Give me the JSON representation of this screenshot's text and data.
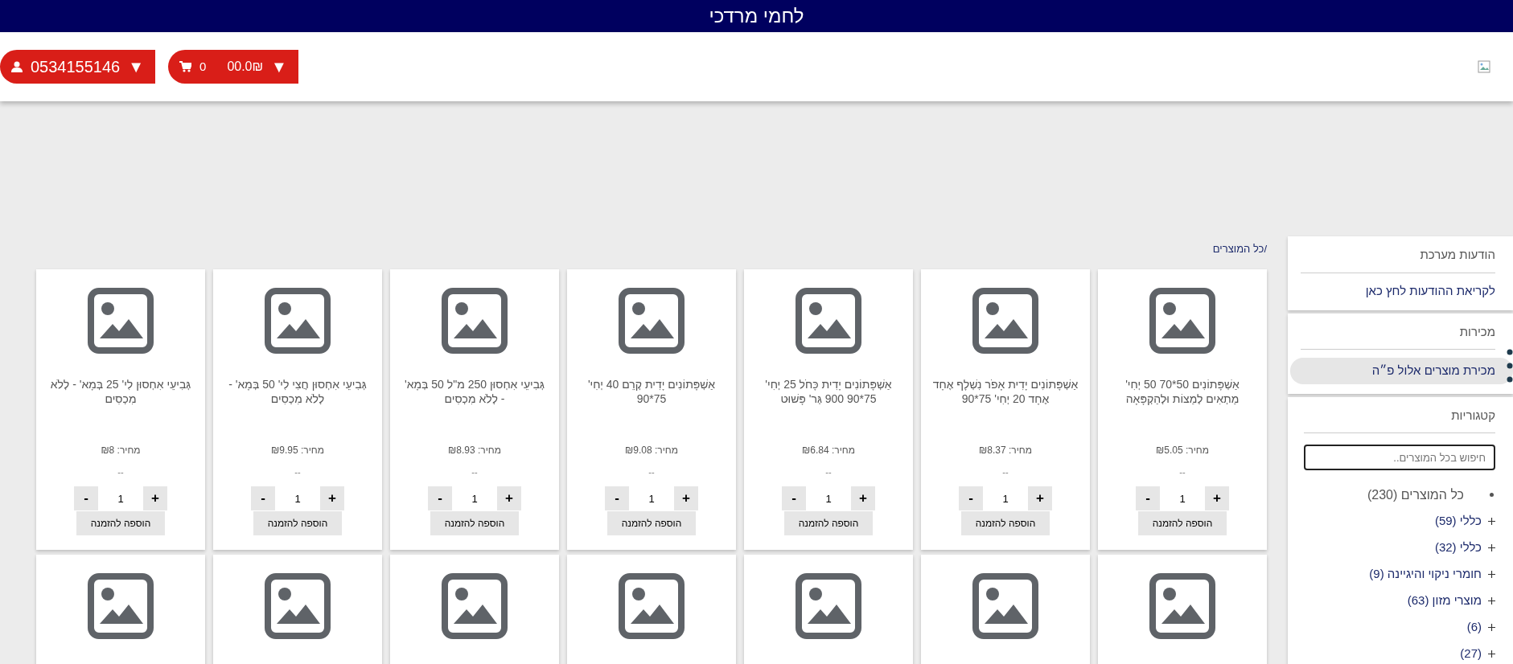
{
  "top_bar": {
    "title": "לחמי מרדכי"
  },
  "header": {
    "user_button": {
      "caret": "▼",
      "phone": "0534155146"
    },
    "cart_button": {
      "caret": "▼",
      "total": "00.0₪",
      "count": "0"
    }
  },
  "breadcrumb": "/כל המוצרים",
  "sidebar": {
    "messages": {
      "title": "הודעות מערכת",
      "link": "לקריאת ההודעות לחץ כאן"
    },
    "sales": {
      "title": "מכירות",
      "items": [
        {
          "label": "מכירת מוצרים אלול פ״ה",
          "selected": true
        }
      ]
    },
    "categories": {
      "title": "קטגוריות",
      "search": {
        "placeholder": "חיפוש בכל המוצרים.."
      },
      "items": [
        {
          "label": "כל המוצרים (230)",
          "selected": true
        },
        {
          "label": "כללי (59)",
          "selected": false
        },
        {
          "label": "כללי (32)",
          "selected": false
        },
        {
          "label": "חומרי ניקוי והיגיינה (9)",
          "selected": false
        },
        {
          "label": "מוצרי מזון (63)",
          "selected": false
        },
        {
          "label": "(6)",
          "selected": false
        },
        {
          "label": "(27)",
          "selected": false
        }
      ]
    }
  },
  "products": [
    {
      "kind": "full",
      "name": "אַשְׁפָּתוֹנִים 50*70 50 יְחִי' מַתְאִים לְמַצוֹת וּלְהַקְפָּאָה",
      "price": "מחיר: ₪5.05",
      "note": "--",
      "quantity": "1",
      "minus": "-",
      "plus": "+",
      "add_button": "הוספה להזמנה"
    },
    {
      "kind": "full",
      "name": "אַשְׁפָּתוֹנִים יָדִית אָפֹר נִשְׁלָף אֶחָד אֶחָד 20 יְחִי' 75*90",
      "price": "מחיר: ₪8.37",
      "note": "--",
      "quantity": "1",
      "minus": "-",
      "plus": "+",
      "add_button": "הוספה להזמנה"
    },
    {
      "kind": "full",
      "name": "אַשְׁפָּתוֹנִים יָדִית כָּחֹל 25 יְחִי' 75*90 900 גְּר' פָּשׁוּט",
      "price": "מחיר: ₪6.84",
      "note": "--",
      "quantity": "1",
      "minus": "-",
      "plus": "+",
      "add_button": "הוספה להזמנה"
    },
    {
      "kind": "full",
      "name": "אַשְׁפָּתוֹנִים יָדִית קְרֵם 40 יְחִי' 75*90",
      "price": "מחיר: ₪9.08",
      "note": "--",
      "quantity": "1",
      "minus": "-",
      "plus": "+",
      "add_button": "הוספה להזמנה"
    },
    {
      "kind": "full",
      "name": "גְּבִיעֵי אִחְסוּן 250 מ\"ל 50 בְּמָא' - לְלֹא מִכְסִים",
      "price": "מחיר: ₪8.93",
      "note": "--",
      "quantity": "1",
      "minus": "-",
      "plus": "+",
      "add_button": "הוספה להזמנה"
    },
    {
      "kind": "full",
      "name": "גְּבִיעֵי אִחְסוּן חֲצִי לִי' 50 בְּמָא' - לְלֹא מִכְסִים",
      "price": "מחיר: ₪9.95",
      "note": "--",
      "quantity": "1",
      "minus": "-",
      "plus": "+",
      "add_button": "הוספה להזמנה"
    },
    {
      "kind": "full",
      "name": "גְּבִיעֵי אִחְסוּן לִי' 25 בְּמָא' - לְלֹא מִכְסִים",
      "price": "מחיר: ₪8",
      "note": "--",
      "quantity": "1",
      "minus": "-",
      "plus": "+",
      "add_button": "הוספה להזמנה"
    },
    {
      "kind": "image_only"
    },
    {
      "kind": "image_only"
    },
    {
      "kind": "image_only"
    },
    {
      "kind": "image_only"
    },
    {
      "kind": "image_only"
    },
    {
      "kind": "image_only"
    },
    {
      "kind": "image_only"
    }
  ]
}
